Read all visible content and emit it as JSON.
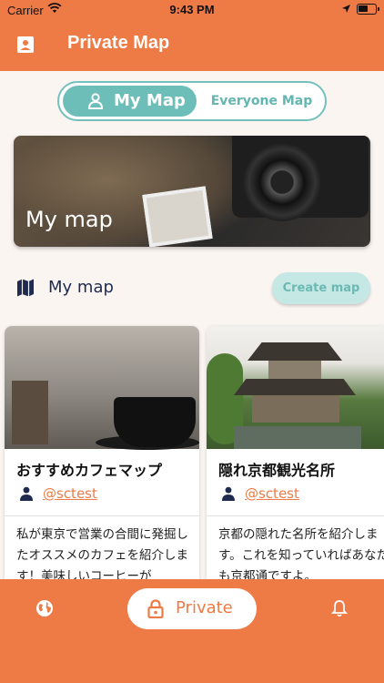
{
  "status_bar": {
    "carrier": "Carrier",
    "time": "9:43 PM"
  },
  "header": {
    "title": "Private Map"
  },
  "segment": {
    "active_label": "My Map",
    "inactive_label": "Everyone Map"
  },
  "banner": {
    "label": "My map"
  },
  "section": {
    "title": "My map",
    "create_button": "Create map"
  },
  "cards": [
    {
      "title": "おすすめカフェマップ",
      "user": "@sctest",
      "description": "私が東京で営業の合間に発掘したオススメのカフェを紹介します！美味しいコーヒーが"
    },
    {
      "title": "隠れ京都観光名所",
      "user": "@sctest",
      "description": "京都の隠れた名所を紹介します。これを知っていればあなたも京都通ですよ。"
    }
  ],
  "bottom_nav": {
    "private_label": "Private"
  },
  "colors": {
    "brand_orange": "#ee7a46",
    "accent_teal": "#6dbeb9"
  }
}
